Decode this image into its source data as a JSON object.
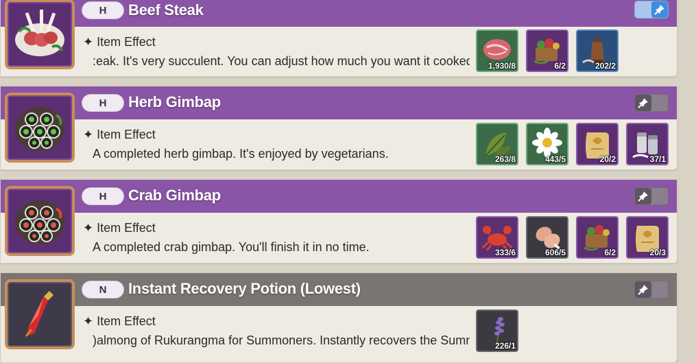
{
  "colors": {
    "header_high": "#8a55a6",
    "header_normal": "#7a7572"
  },
  "items": [
    {
      "grade": "H",
      "name": "Beef Steak",
      "effect_title": "Item Effect",
      "description": ":eak. It's very succulent. You can adjust how much you want it cooked.",
      "pinned": true,
      "pin_icon": "pin-icon",
      "ingredients": [
        {
          "icon": "raw-meat-icon",
          "count": "1,930/8"
        },
        {
          "icon": "herb-basket-icon",
          "count": "6/2"
        },
        {
          "icon": "pepper-grinder-icon",
          "count": "202/2"
        }
      ]
    },
    {
      "grade": "H",
      "name": "Herb Gimbap",
      "effect_title": "Item Effect",
      "description": "A completed herb gimbap. It's enjoyed by vegetarians.",
      "pinned": false,
      "pin_icon": "pin-icon",
      "ingredients": [
        {
          "icon": "leaf-icon",
          "count": "263/8"
        },
        {
          "icon": "flower-icon",
          "count": "443/5"
        },
        {
          "icon": "recipe-scroll-icon",
          "count": "20/2"
        },
        {
          "icon": "salt-shaker-icon",
          "count": "37/1"
        }
      ]
    },
    {
      "grade": "H",
      "name": "Crab Gimbap",
      "effect_title": "Item Effect",
      "description": "A completed crab gimbap. You'll finish it in no time.",
      "pinned": false,
      "pin_icon": "pin-icon",
      "ingredients": [
        {
          "icon": "crab-icon",
          "count": "333/6"
        },
        {
          "icon": "drumstick-icon",
          "count": "606/5"
        },
        {
          "icon": "herb-basket-icon",
          "count": "6/2"
        },
        {
          "icon": "recipe-scroll-icon",
          "count": "20/3"
        }
      ]
    },
    {
      "grade": "N",
      "name": "Instant Recovery Potion (Lowest)",
      "effect_title": "Item Effect",
      "description": ")almong of Rukurangma for Summoners. Instantly recovers the Sumn",
      "pinned": false,
      "pin_icon": "pin-icon",
      "ingredients": [
        {
          "icon": "lavender-icon",
          "count": "226/1"
        }
      ]
    }
  ]
}
